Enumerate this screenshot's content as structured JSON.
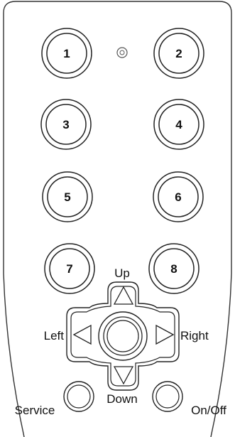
{
  "remote": {
    "number_buttons": [
      {
        "label": "1"
      },
      {
        "label": "2"
      },
      {
        "label": "3"
      },
      {
        "label": "4"
      },
      {
        "label": "5"
      },
      {
        "label": "6"
      },
      {
        "label": "7"
      },
      {
        "label": "8"
      }
    ],
    "dpad": {
      "up_label": "Up",
      "down_label": "Down",
      "left_label": "Left",
      "right_label": "Right"
    },
    "service_label": "Service",
    "onoff_label": "On/Off",
    "icons": {
      "indicator": "led-indicator-icon",
      "up": "triangle-up-icon",
      "down": "triangle-down-icon",
      "left": "triangle-left-icon",
      "right": "triangle-right-icon"
    }
  }
}
